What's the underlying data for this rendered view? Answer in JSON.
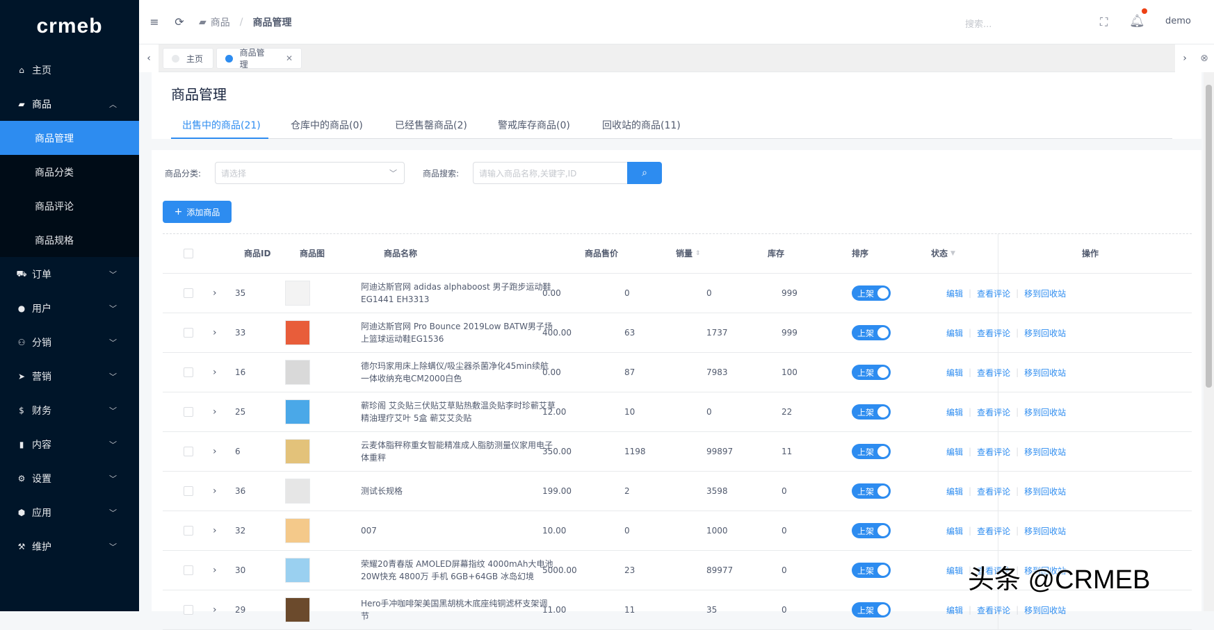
{
  "app": {
    "logo": "crmeb"
  },
  "sidebar": {
    "items": [
      {
        "label": "主页",
        "icon": "home-icon"
      },
      {
        "label": "商品",
        "icon": "basket-icon",
        "expanded": true
      },
      {
        "label": "订单",
        "icon": "cart-icon"
      },
      {
        "label": "用户",
        "icon": "user-icon"
      },
      {
        "label": "分销",
        "icon": "group-icon"
      },
      {
        "label": "营销",
        "icon": "send-icon"
      },
      {
        "label": "财务",
        "icon": "dollar-icon"
      },
      {
        "label": "内容",
        "icon": "book-icon"
      },
      {
        "label": "设置",
        "icon": "gear-icon"
      },
      {
        "label": "应用",
        "icon": "cube-icon"
      },
      {
        "label": "维护",
        "icon": "hammer-icon"
      }
    ],
    "sub_items": [
      "商品管理",
      "商品分类",
      "商品评论",
      "商品规格"
    ]
  },
  "header": {
    "breadcrumb": [
      "商品",
      "商品管理"
    ],
    "search_placeholder": "搜索...",
    "user": "demo"
  },
  "tabs": {
    "home": "主页",
    "current": "商品管理"
  },
  "page": {
    "title": "商品管理",
    "tabs": [
      "出售中的商品(21)",
      "仓库中的商品(0)",
      "已经售罄商品(2)",
      "警戒库存商品(0)",
      "回收站的商品(11)"
    ]
  },
  "filters": {
    "category_label": "商品分类:",
    "category_placeholder": "请选择",
    "search_label": "商品搜索:",
    "search_placeholder": "请输入商品名称,关键字,ID"
  },
  "add_button": "添加商品",
  "table": {
    "headers": {
      "id": "商品ID",
      "image": "商品图",
      "name": "商品名称",
      "price": "商品售价",
      "sales": "销量",
      "stock": "库存",
      "sort": "排序",
      "status": "状态",
      "actions": "操作"
    },
    "rows": [
      {
        "id": "35",
        "name": "阿迪达斯官网 adidas alphaboost 男子跑步运动鞋EG1441 EH3313",
        "price": "0.00",
        "sales": "0",
        "stock": "0",
        "sort": "999",
        "status": "上架"
      },
      {
        "id": "33",
        "name": "阿迪达斯官网 Pro Bounce 2019Low BATW男子场上篮球运动鞋EG1536",
        "price": "400.00",
        "sales": "63",
        "stock": "1737",
        "sort": "999",
        "status": "上架"
      },
      {
        "id": "16",
        "name": "德尔玛家用床上除螨仪/吸尘器杀菌净化45min续航一体收纳充电CM2000白色",
        "price": "0.00",
        "sales": "87",
        "stock": "7983",
        "sort": "100",
        "status": "上架"
      },
      {
        "id": "25",
        "name": "蕲珍阁 艾灸贴三伏贴艾草贴热敷温灸贴李时珍蕲艾草精油理疗艾叶 5盒 蕲艾艾灸贴",
        "price": "12.00",
        "sales": "10",
        "stock": "0",
        "sort": "22",
        "status": "上架"
      },
      {
        "id": "6",
        "name": "云麦体脂秤称重女智能精准成人脂肪测量仪家用电子体重秤",
        "price": "350.00",
        "sales": "1198",
        "stock": "99897",
        "sort": "11",
        "status": "上架"
      },
      {
        "id": "36",
        "name": "测试长规格",
        "price": "199.00",
        "sales": "2",
        "stock": "3598",
        "sort": "0",
        "status": "上架"
      },
      {
        "id": "32",
        "name": "007",
        "price": "10.00",
        "sales": "0",
        "stock": "1000",
        "sort": "0",
        "status": "上架"
      },
      {
        "id": "30",
        "name": "荣耀20青春版 AMOLED屏幕指纹 4000mAh大电池 20W快充 4800万 手机 6GB+64GB 冰岛幻境",
        "price": "5000.00",
        "sales": "23",
        "stock": "89977",
        "sort": "0",
        "status": "上架"
      },
      {
        "id": "29",
        "name": "Hero手冲咖啡架美国黑胡桃木底座纯铜滤杯支架调节",
        "price": "11.00",
        "sales": "11",
        "stock": "35",
        "sort": "0",
        "status": "上架"
      }
    ],
    "actions": [
      "编辑",
      "查看评论",
      "移到回收站"
    ]
  },
  "watermark": "头条 @CRMEB",
  "colors": {
    "primary": "#2d8cf0",
    "sidebar": "#001529",
    "badge": "#ed4014"
  }
}
